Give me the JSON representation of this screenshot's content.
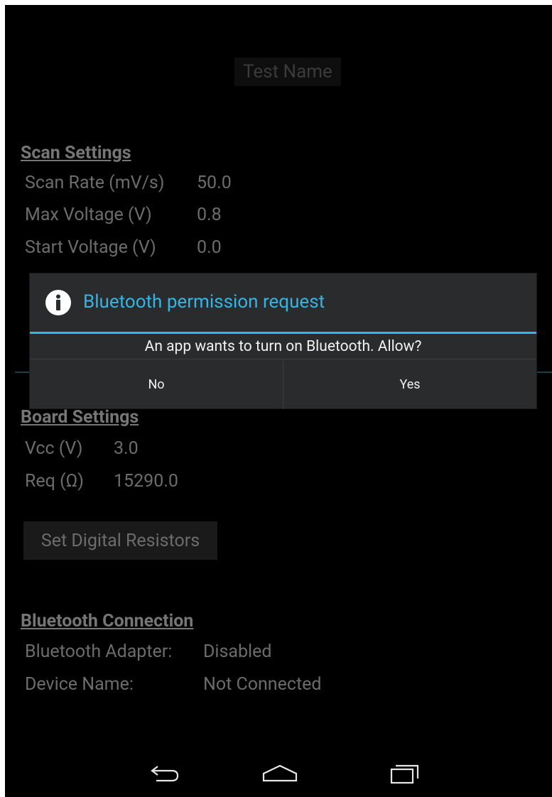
{
  "test_name": "Test Name",
  "scan_settings": {
    "title": "Scan Settings",
    "rows": [
      {
        "label": "Scan Rate (mV/s)",
        "value": "50.0"
      },
      {
        "label": "Max Voltage (V)",
        "value": "0.8"
      },
      {
        "label": "Start Voltage (V)",
        "value": "0.0"
      }
    ]
  },
  "board_settings": {
    "title": "Board Settings",
    "rows": [
      {
        "label": "Vcc (V)",
        "value": "3.0"
      },
      {
        "label": "Req (Ω)",
        "value": "15290.0"
      }
    ],
    "button_label": "Set Digital Resistors"
  },
  "bluetooth": {
    "title": "Bluetooth Connection",
    "rows": [
      {
        "label": "Bluetooth Adapter:",
        "value": "Disabled"
      },
      {
        "label": "Device Name:",
        "value": "Not Connected"
      }
    ]
  },
  "dialog": {
    "title": "Bluetooth permission request",
    "message": "An app wants to turn on Bluetooth. Allow?",
    "no_label": "No",
    "yes_label": "Yes",
    "icon": "info-icon",
    "accent_color": "#33b5e5"
  },
  "navbar": {
    "icons": [
      "back-icon",
      "home-icon",
      "recent-apps-icon"
    ]
  }
}
